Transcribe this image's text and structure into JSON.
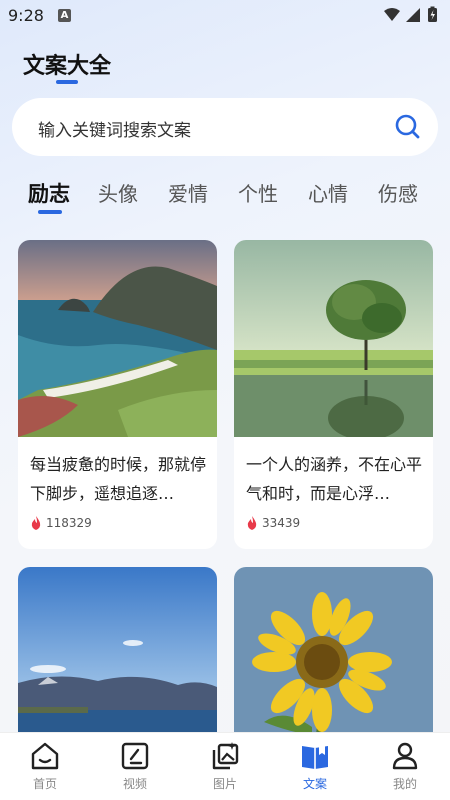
{
  "status": {
    "time": "9:28",
    "a_badge": "A"
  },
  "header": {
    "title": "文案大全"
  },
  "search": {
    "placeholder": "输入关键词搜索文案"
  },
  "tabs": [
    {
      "label": "励志"
    },
    {
      "label": "头像"
    },
    {
      "label": "爱情"
    },
    {
      "label": "个性"
    },
    {
      "label": "心情"
    },
    {
      "label": "伤感"
    }
  ],
  "cards": [
    {
      "text": "每当疲惫的时候，那就停下脚步，遥想追逐…",
      "views": "118329"
    },
    {
      "text": "一个人的涵养，不在心平气和时，而是心浮…",
      "views": "33439"
    },
    {
      "text": "",
      "views": ""
    },
    {
      "text": "",
      "views": ""
    }
  ],
  "nav": [
    {
      "label": "首页"
    },
    {
      "label": "视频"
    },
    {
      "label": "图片"
    },
    {
      "label": "文案"
    },
    {
      "label": "我的"
    }
  ],
  "colors": {
    "accent": "#2a68e0",
    "heat": "#e83a4a"
  }
}
